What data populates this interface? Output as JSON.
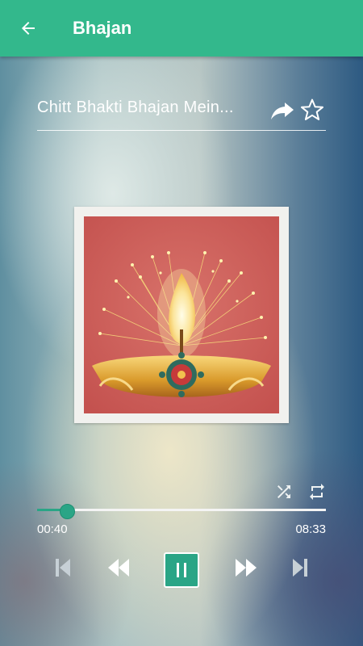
{
  "app_bar": {
    "title": "Bhajan",
    "back_icon": "arrow-left-icon"
  },
  "track": {
    "title": "Chitt Bhakti Bhajan Mein...",
    "share_icon": "share-icon",
    "favorite_icon": "star-outline-icon"
  },
  "artwork": {
    "description_icon": "diya-lamp-artwork"
  },
  "player": {
    "shuffle_icon": "shuffle-icon",
    "repeat_icon": "repeat-icon",
    "elapsed": "00:40",
    "duration": "08:33",
    "progress_fraction": 0.1,
    "skip_previous_icon": "skip-previous-icon",
    "rewind_icon": "rewind-icon",
    "pause_icon": "pause-icon",
    "fast_forward_icon": "fast-forward-icon",
    "skip_next_icon": "skip-next-icon"
  },
  "colors": {
    "accent": "#33b88c",
    "player_accent": "#2aa586"
  }
}
